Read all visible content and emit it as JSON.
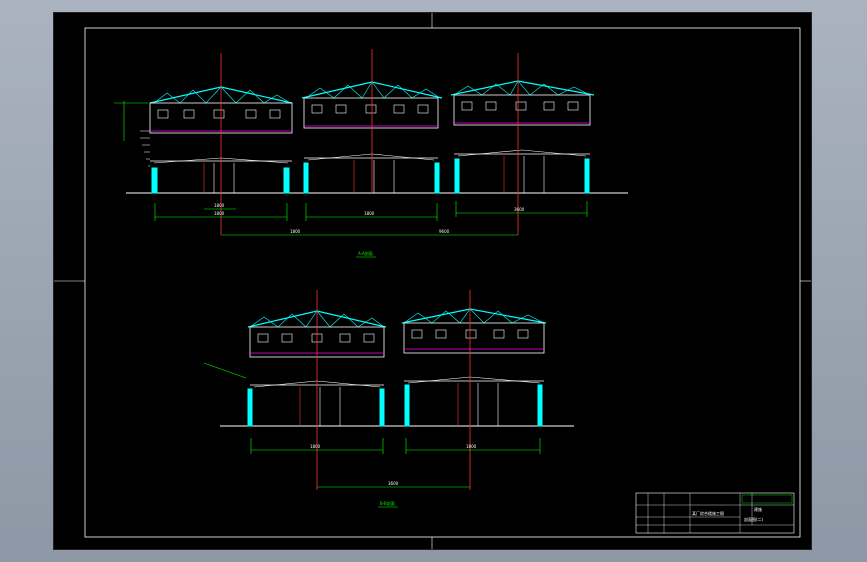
{
  "drawing": {
    "colors": {
      "sheet_bg": "#000000",
      "frame": "#ffffff",
      "structure": "#ffffff",
      "truss": "#00ffff",
      "axis": "#ff3030",
      "dimension": "#00ff00",
      "highlight": "#ff00ff",
      "column": "#00ffff"
    },
    "top_section": {
      "title": "A-A剖面",
      "dimensions": [
        "1800",
        "1800",
        "1800",
        "3600",
        "1800",
        "9600"
      ]
    },
    "bottom_section": {
      "title": "B-B剖面",
      "dimensions": [
        "1800",
        "1800",
        "3600"
      ]
    },
    "title_block": {
      "project": "某厂综合楼施工图",
      "drawing_name": "剖面图(二)",
      "sheet_label": "建施"
    }
  }
}
